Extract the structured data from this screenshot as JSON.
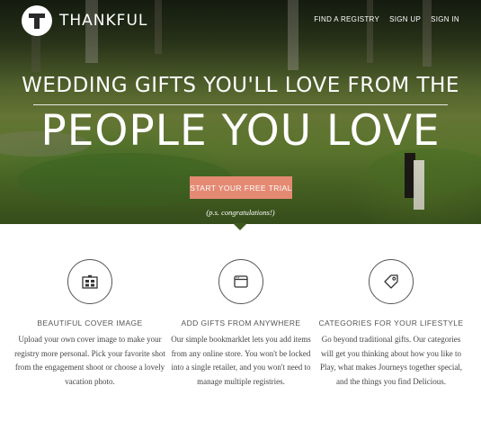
{
  "header": {
    "brand": "THANKFUL",
    "nav": [
      "FIND A REGISTRY",
      "SIGN UP",
      "SIGN IN"
    ]
  },
  "hero": {
    "headline_line1": "WEDDING GIFTS YOU'LL LOVE FROM THE",
    "headline_line2": "PEOPLE YOU LOVE",
    "cta_label": "START YOUR FREE TRIAL",
    "ps": "(p.s. congratulations!)"
  },
  "features": [
    {
      "icon": "cover-image-icon",
      "title": "BEAUTIFUL COVER IMAGE",
      "description": "Upload your own cover image to make your registry more personal. Pick your favorite shot from the engagement shoot or choose a lovely vacation photo."
    },
    {
      "icon": "browser-window-icon",
      "title": "ADD GIFTS FROM ANYWHERE",
      "description": "Our simple bookmarklet lets you add items from any online store. You won't be locked into a single retailer, and you won't need to manage multiple registries."
    },
    {
      "icon": "tag-icon",
      "title": "CATEGORIES FOR YOUR LIFESTYLE",
      "description": "Go beyond traditional gifts. Our categories will get you thinking about how you like to Play, what makes Journeys together special, and the things you find Delicious."
    }
  ],
  "colors": {
    "cta": "#e48a73",
    "hero_green": "#5f7b2f",
    "text": "#444444"
  }
}
